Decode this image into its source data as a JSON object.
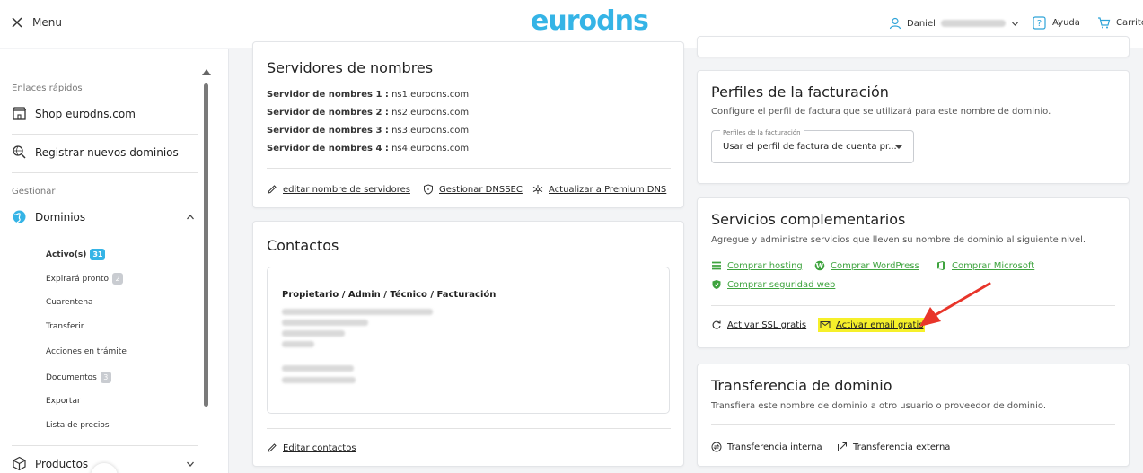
{
  "header": {
    "menu_label": "Menu",
    "logo_text": "eurodns",
    "user_name": "Daniel",
    "help_label": "Ayuda",
    "cart_label": "Carrito"
  },
  "sidebar": {
    "quick_links_title": "Enlaces rápidos",
    "shop_label": "Shop eurodns.com",
    "register_label": "Registrar nuevos dominios",
    "manage_title": "Gestionar",
    "domains_label": "Dominios",
    "sub_items": [
      {
        "label": "Activo(s)",
        "badge": "31"
      },
      {
        "label": "Expirará pronto",
        "badge": "2"
      },
      {
        "label": "Cuarentena",
        "badge": ""
      },
      {
        "label": "Transferir",
        "badge": ""
      },
      {
        "label": "Acciones en trámite",
        "badge": ""
      },
      {
        "label": "Documentos",
        "badge": "3"
      },
      {
        "label": "Exportar",
        "badge": ""
      },
      {
        "label": "Lista de precios",
        "badge": ""
      }
    ],
    "products_label": "Productos"
  },
  "nameservers": {
    "title": "Servidores de nombres",
    "rows": [
      {
        "label": "Servidor de nombres 1 :",
        "value": "ns1.eurodns.com"
      },
      {
        "label": "Servidor de nombres 2 :",
        "value": "ns2.eurodns.com"
      },
      {
        "label": "Servidor de nombres 3 :",
        "value": "ns3.eurodns.com"
      },
      {
        "label": "Servidor de nombres 4 :",
        "value": "ns4.eurodns.com"
      }
    ],
    "edit_label": "editar nombre de servidores",
    "dnssec_label": "Gestionar DNSSEC",
    "premium_label": "Actualizar a Premium DNS"
  },
  "contacts": {
    "title": "Contactos",
    "heading": "Propietario / Admin / Técnico / Facturación",
    "edit_label": "Editar contactos"
  },
  "billing": {
    "title": "Perfiles de la facturación",
    "description": "Configure el perfil de factura que se utilizará para este nombre de dominio.",
    "select_label": "Perfiles de la facturación",
    "select_value": "Usar el perfil de factura de cuenta pr..."
  },
  "services": {
    "title": "Servicios complementarios",
    "description": "Agregue y administre servicios que lleven su nombre de dominio al siguiente nivel.",
    "hosting_label": "Comprar hosting",
    "wordpress_label": "Comprar WordPress",
    "microsoft_label": "Comprar Microsoft",
    "security_label": "Comprar seguridad web",
    "ssl_label": "Activar SSL gratis",
    "email_label": "Activar email gratis",
    "highlight_color": "#f6f02a",
    "arrow_color": "#e8352a"
  },
  "transfer": {
    "title": "Transferencia de dominio",
    "description": "Transfiera este nombre de dominio a otro usuario o proveedor de dominio.",
    "internal_label": "Transferencia interna",
    "external_label": "Transferencia externa"
  },
  "colors": {
    "brand": "#35b4e6",
    "link_green": "#3ea33e"
  }
}
